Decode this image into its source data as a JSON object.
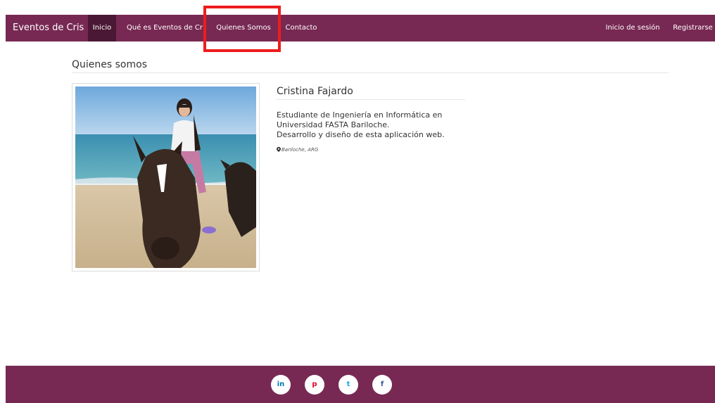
{
  "navbar": {
    "brand": "Eventos de Cris",
    "items": [
      {
        "label": "Inicio"
      },
      {
        "label": "Qué es Eventos de Cris"
      },
      {
        "label": "Quienes Somos"
      },
      {
        "label": "Contacto"
      }
    ],
    "right_items": [
      {
        "label": "Inicio de sesión"
      },
      {
        "label": "Registrarse"
      }
    ]
  },
  "main": {
    "section_title": "Quienes somos",
    "profile": {
      "name": "Cristina Fajardo",
      "bio_lines": [
        "Estudiante de Ingeniería en Informática en",
        "Universidad FASTA Bariloche.",
        "Desarrollo y diseño de esta aplicación web."
      ],
      "location": "Bariloche, ARG"
    }
  },
  "footer": {
    "social": [
      {
        "label": "in",
        "icon": "linkedin-icon",
        "color": "#0077b5"
      },
      {
        "label": "p",
        "icon": "pinterest-icon",
        "color": "#e60023"
      },
      {
        "label": "t",
        "icon": "twitter-icon",
        "color": "#1da1f2"
      },
      {
        "label": "f",
        "icon": "facebook-icon",
        "color": "#3b5998"
      }
    ]
  },
  "colors": {
    "brand": "#772953",
    "active": "#4a1834",
    "highlight": "#ee1c1c"
  }
}
